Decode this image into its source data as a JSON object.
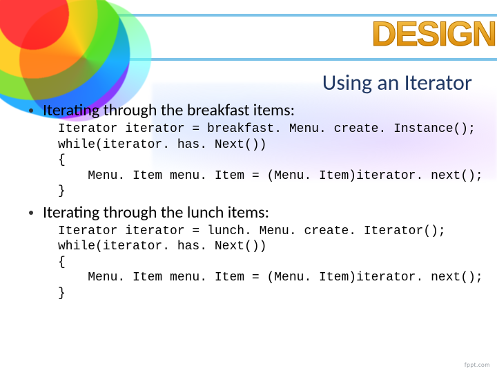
{
  "brand": "DESIGN",
  "title": "Using an Iterator",
  "bullets": [
    {
      "label": "Iterating through the breakfast items:",
      "code_lines": [
        "Iterator iterator = breakfast. Menu. create. Instance();",
        "while(iterator. has. Next())",
        "{",
        "    Menu. Item menu. Item = (Menu. Item)iterator. next();",
        "}"
      ]
    },
    {
      "label": "Iterating through the lunch items:",
      "code_lines": [
        "Iterator iterator = lunch. Menu. create. Iterator();",
        "while(iterator. has. Next())",
        "{",
        "    Menu. Item menu. Item = (Menu. Item)iterator. next();",
        "}"
      ]
    }
  ],
  "footer": "fppt.com"
}
